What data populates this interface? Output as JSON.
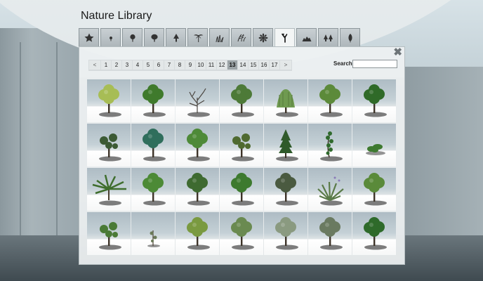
{
  "app": {
    "title": "Nature Library"
  },
  "tabs": [
    {
      "icon": "star-icon",
      "active": false
    },
    {
      "icon": "small-tree-icon",
      "active": false
    },
    {
      "icon": "round-tree-icon",
      "active": false
    },
    {
      "icon": "broad-tree-icon",
      "active": false
    },
    {
      "icon": "conifer-icon",
      "active": false
    },
    {
      "icon": "palm-icon",
      "active": false
    },
    {
      "icon": "grass-icon",
      "active": false
    },
    {
      "icon": "fern-icon",
      "active": false
    },
    {
      "icon": "flower-icon",
      "active": false
    },
    {
      "icon": "bare-tree-icon",
      "active": true
    },
    {
      "icon": "rock-icon",
      "active": false
    },
    {
      "icon": "forest-icon",
      "active": false
    },
    {
      "icon": "leaf-icon",
      "active": false
    }
  ],
  "panel": {
    "close_icon": "close-icon",
    "pagination": {
      "prev": "<",
      "next": ">",
      "pages": [
        "1",
        "2",
        "3",
        "4",
        "5",
        "6",
        "7",
        "8",
        "9",
        "10",
        "11",
        "12",
        "13",
        "14",
        "15",
        "16",
        "17"
      ],
      "current": "13"
    },
    "search": {
      "label": "Search",
      "value": ""
    }
  },
  "thumbnails": [
    {
      "kind": "leafy",
      "color": "#a7bd55"
    },
    {
      "kind": "leafy",
      "color": "#3f7a2c"
    },
    {
      "kind": "bare",
      "color": "#5a5a55"
    },
    {
      "kind": "leafy",
      "color": "#4d7a38"
    },
    {
      "kind": "willow",
      "color": "#6f9a50"
    },
    {
      "kind": "leafy",
      "color": "#5c8a3a"
    },
    {
      "kind": "leafy",
      "color": "#2f6a28"
    },
    {
      "kind": "sparse",
      "color": "#3c5a34"
    },
    {
      "kind": "leafy",
      "color": "#2f6e5c"
    },
    {
      "kind": "leafy",
      "color": "#4e8a38"
    },
    {
      "kind": "sparse",
      "color": "#4f6a30"
    },
    {
      "kind": "conifer",
      "color": "#2f5a2a"
    },
    {
      "kind": "vine",
      "color": "#2f6a2c"
    },
    {
      "kind": "shrub",
      "color": "#3e7a30"
    },
    {
      "kind": "palm",
      "color": "#3f6e2e"
    },
    {
      "kind": "leafy",
      "color": "#4c8a36"
    },
    {
      "kind": "leafy",
      "color": "#3e6a30"
    },
    {
      "kind": "leafy",
      "color": "#3d7a2e"
    },
    {
      "kind": "leafy",
      "color": "#4a5a40"
    },
    {
      "kind": "agave",
      "color": "#5a7a48"
    },
    {
      "kind": "leafy",
      "color": "#5a8a3a"
    },
    {
      "kind": "sparse",
      "color": "#4a7a36"
    },
    {
      "kind": "sapling",
      "color": "#6a7a58"
    },
    {
      "kind": "leafy",
      "color": "#7a9a40"
    },
    {
      "kind": "leafy",
      "color": "#6a8a50"
    },
    {
      "kind": "leafy",
      "color": "#8a9a80"
    },
    {
      "kind": "leafy",
      "color": "#6a7a60"
    },
    {
      "kind": "leafy",
      "color": "#2e6a2a"
    }
  ],
  "colors": {
    "panel": "#eef1f2",
    "tab": "#b7c0c4",
    "current_page": "#9ba3a6"
  }
}
